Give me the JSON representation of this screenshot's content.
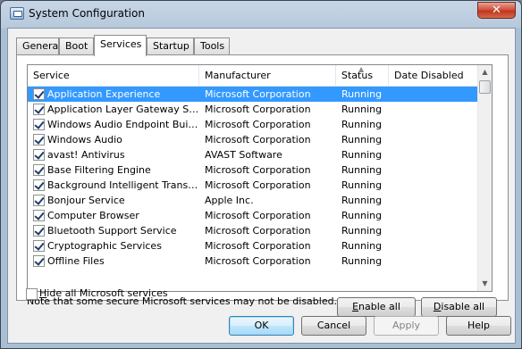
{
  "window": {
    "title": "System Configuration",
    "close_glyph": "✕",
    "icon": "msconfig-icon"
  },
  "tabs": [
    {
      "label": "General",
      "active": false
    },
    {
      "label": "Boot",
      "active": false
    },
    {
      "label": "Services",
      "active": true
    },
    {
      "label": "Startup",
      "active": false
    },
    {
      "label": "Tools",
      "active": false
    }
  ],
  "list": {
    "columns": [
      "Service",
      "Manufacturer",
      "Status",
      "Date Disabled"
    ],
    "sorted_column": "Status",
    "rows": [
      {
        "service": "Application Experience",
        "manufacturer": "Microsoft Corporation",
        "status": "Running",
        "date_disabled": "",
        "checked": true,
        "selected": true
      },
      {
        "service": "Application Layer Gateway Service",
        "manufacturer": "Microsoft Corporation",
        "status": "Running",
        "date_disabled": "",
        "checked": true,
        "selected": false
      },
      {
        "service": "Windows Audio Endpoint Builder",
        "manufacturer": "Microsoft Corporation",
        "status": "Running",
        "date_disabled": "",
        "checked": true,
        "selected": false
      },
      {
        "service": "Windows Audio",
        "manufacturer": "Microsoft Corporation",
        "status": "Running",
        "date_disabled": "",
        "checked": true,
        "selected": false
      },
      {
        "service": "avast! Antivirus",
        "manufacturer": "AVAST Software",
        "status": "Running",
        "date_disabled": "",
        "checked": true,
        "selected": false
      },
      {
        "service": "Base Filtering Engine",
        "manufacturer": "Microsoft Corporation",
        "status": "Running",
        "date_disabled": "",
        "checked": true,
        "selected": false
      },
      {
        "service": "Background Intelligent Transfer ...",
        "manufacturer": "Microsoft Corporation",
        "status": "Running",
        "date_disabled": "",
        "checked": true,
        "selected": false
      },
      {
        "service": "Bonjour Service",
        "manufacturer": "Apple Inc.",
        "status": "Running",
        "date_disabled": "",
        "checked": true,
        "selected": false
      },
      {
        "service": "Computer Browser",
        "manufacturer": "Microsoft Corporation",
        "status": "Running",
        "date_disabled": "",
        "checked": true,
        "selected": false
      },
      {
        "service": "Bluetooth Support Service",
        "manufacturer": "Microsoft Corporation",
        "status": "Running",
        "date_disabled": "",
        "checked": true,
        "selected": false
      },
      {
        "service": "Cryptographic Services",
        "manufacturer": "Microsoft Corporation",
        "status": "Running",
        "date_disabled": "",
        "checked": true,
        "selected": false
      },
      {
        "service": "Offline Files",
        "manufacturer": "Microsoft Corporation",
        "status": "Running",
        "date_disabled": "",
        "checked": true,
        "selected": false
      }
    ]
  },
  "note": "Note that some secure Microsoft services may not be disabled.",
  "enable_all": {
    "prefix": "",
    "accel": "E",
    "rest": "nable all"
  },
  "disable_all": {
    "prefix": "",
    "accel": "D",
    "rest": "isable all"
  },
  "hide_ms": {
    "prefix": "",
    "accel": "H",
    "rest": "ide all Microsoft services",
    "checked": false
  },
  "buttons": {
    "ok": "OK",
    "cancel": "Cancel",
    "apply": "Apply",
    "help": "Help"
  },
  "colors": {
    "selection": "#3399ff",
    "close": "#c1361f",
    "default_button": "#3c7fb1"
  }
}
